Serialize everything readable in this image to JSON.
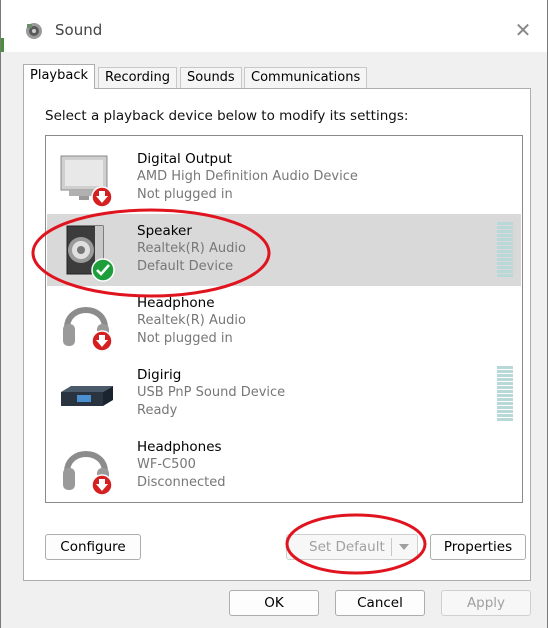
{
  "window": {
    "title": "Sound",
    "close_glyph": "✕"
  },
  "tabs": [
    {
      "label": "Playback",
      "active": true
    },
    {
      "label": "Recording",
      "active": false
    },
    {
      "label": "Sounds",
      "active": false
    },
    {
      "label": "Communications",
      "active": false
    }
  ],
  "instruction": "Select a playback device below to modify its settings:",
  "devices": [
    {
      "name": "Digital Output",
      "description": "AMD High Definition Audio Device",
      "status": "Not plugged in",
      "icon": "monitor-icon",
      "badge": "red-down-arrow-icon"
    },
    {
      "name": "Speaker",
      "description": "Realtek(R) Audio",
      "status": "Default Device",
      "icon": "speaker-icon",
      "badge": "green-check-icon",
      "selected": true
    },
    {
      "name": "Headphone",
      "description": "Realtek(R) Audio",
      "status": "Not plugged in",
      "icon": "headphone-icon",
      "badge": "red-down-arrow-icon"
    },
    {
      "name": "Digirig",
      "description": "USB PnP Sound Device",
      "status": "Ready",
      "icon": "usb-sound-device-icon"
    },
    {
      "name": "Headphones",
      "description": "WF-C500",
      "status": "Disconnected",
      "icon": "headphone-icon",
      "badge": "red-down-arrow-icon"
    }
  ],
  "buttons": {
    "configure": "Configure",
    "set_default": "Set Default",
    "properties": "Properties",
    "ok": "OK",
    "cancel": "Cancel",
    "apply": "Apply"
  },
  "colors": {
    "annotation_red": "#e0141e",
    "selection_bg": "#d9d9d9",
    "check_green": "#1e9e3a",
    "arrow_red": "#d42020"
  }
}
